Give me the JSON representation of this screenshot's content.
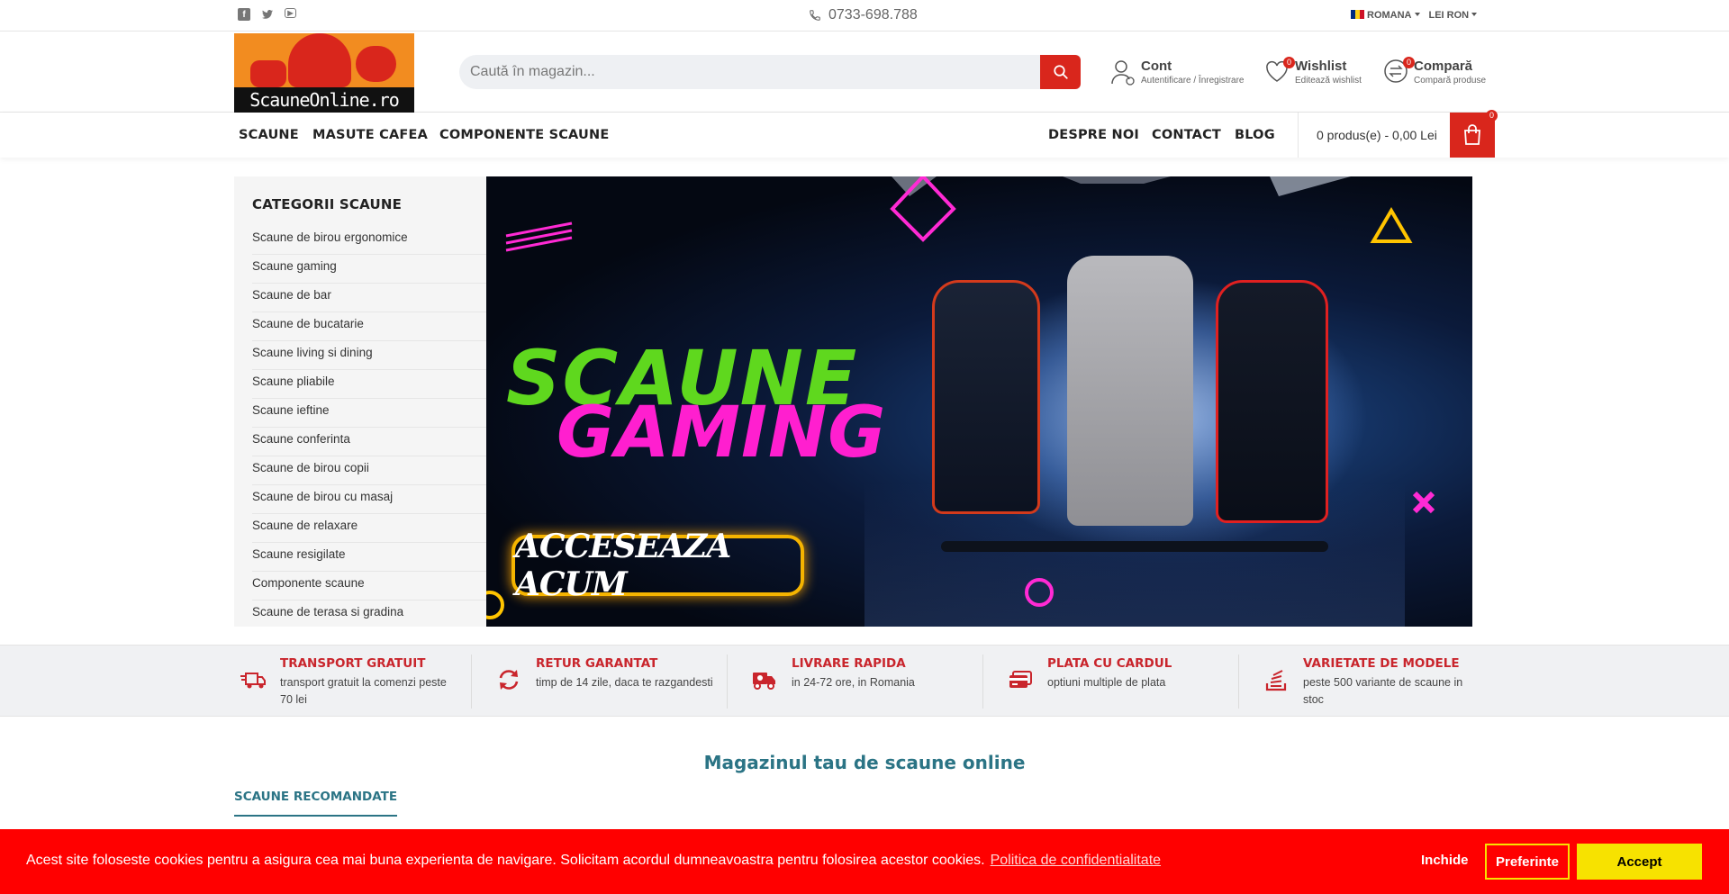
{
  "topbar": {
    "social": [
      "facebook-icon",
      "twitter-icon",
      "youtube-icon"
    ],
    "phone": "0733-698.788",
    "language": "ROMANA",
    "currency": "LEI RON"
  },
  "header": {
    "logo_text": "ScauneOnline.ro",
    "search_placeholder": "Caută în magazin...",
    "account": {
      "title": "Cont",
      "subtitle": "Autentificare / Înregistrare"
    },
    "wishlist": {
      "title": "Wishlist",
      "subtitle": "Editează wishlist",
      "count": "0"
    },
    "compare": {
      "title": "Compară",
      "subtitle": "Compară produse",
      "count": "0"
    }
  },
  "nav": {
    "left": [
      "SCAUNE",
      "MASUTE CAFEA",
      "COMPONENTE SCAUNE"
    ],
    "right": [
      "DESPRE NOI",
      "CONTACT",
      "BLOG"
    ],
    "cart_text": "0 produs(e) - 0,00 Lei",
    "cart_count": "0"
  },
  "sidebar": {
    "title": "CATEGORII SCAUNE",
    "items": [
      "Scaune de birou ergonomice",
      "Scaune gaming",
      "Scaune de bar",
      "Scaune de bucatarie",
      "Scaune living si dining",
      "Scaune pliabile",
      "Scaune ieftine",
      "Scaune conferinta",
      "Scaune de birou copii",
      "Scaune de birou cu masaj",
      "Scaune de relaxare",
      "Scaune resigilate",
      "Componente scaune",
      "Scaune de terasa si gradina"
    ]
  },
  "banner": {
    "line1": "SCAUNE",
    "line2": "GAMING",
    "cta": "ACCESEAZA ACUM"
  },
  "features": [
    {
      "title": "TRANSPORT GRATUIT",
      "desc": "transport gratuit la comenzi peste 70 lei",
      "icon": "truck-icon"
    },
    {
      "title": "RETUR GARANTAT",
      "desc": "timp de 14 zile, daca te razgandesti",
      "icon": "refresh-icon"
    },
    {
      "title": "LIVRARE RAPIDA",
      "desc": "in 24-72 ore, in Romania",
      "icon": "delivery-icon"
    },
    {
      "title": "PLATA CU CARDUL",
      "desc": "optiuni multiple de plata",
      "icon": "credit-card-icon"
    },
    {
      "title": "VARIETATE DE MODELE",
      "desc": "peste 500 variante de scaune in stoc",
      "icon": "stack-icon"
    }
  ],
  "main": {
    "title": "Magazinul tau de scaune online",
    "tab": "SCAUNE RECOMANDATE"
  },
  "cookie": {
    "message": "Acest site foloseste cookies pentru a asigura cea mai buna experienta de navigare. Solicitam acordul dumneavoastra pentru folosirea acestor cookies.",
    "policy_link": "Politica de confidentialitate",
    "close": "Inchide",
    "preferences": "Preferinte",
    "accept": "Accept"
  },
  "colors": {
    "brand_red": "#d9261c",
    "feature_red": "#c9252c",
    "teal": "#2b7485",
    "cookie_bg": "#ff0000",
    "cookie_accept": "#f7e200"
  }
}
